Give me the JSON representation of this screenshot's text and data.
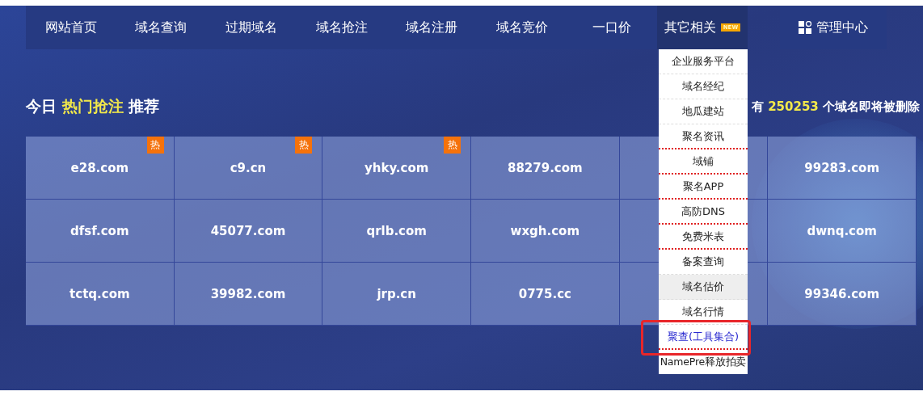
{
  "nav": {
    "items": [
      {
        "label": "网站首页",
        "selected": false
      },
      {
        "label": "域名查询",
        "selected": false
      },
      {
        "label": "过期域名",
        "selected": false
      },
      {
        "label": "域名抢注",
        "selected": false
      },
      {
        "label": "域名注册",
        "selected": false
      },
      {
        "label": "域名竞价",
        "selected": false
      },
      {
        "label": "一口价",
        "selected": false
      },
      {
        "label": "其它相关",
        "selected": true,
        "badge": "NEW"
      }
    ],
    "admin": {
      "label": "管理中心"
    }
  },
  "heading": "今日 **热门抢注** 推荐",
  "notice": {
    "prefix": "有",
    "count": "250253",
    "suffix": "个域名即将被删除"
  },
  "domains": [
    [
      {
        "name": "e28.com",
        "hot": true,
        "badge": "热"
      },
      {
        "name": "c9.cn",
        "hot": true,
        "badge": "热"
      },
      {
        "name": "yhky.com",
        "hot": true,
        "badge": "热"
      },
      {
        "name": "88279.com",
        "hot": false
      },
      {
        "hot": false
      },
      {
        "name": "99283.com",
        "hot": false
      }
    ],
    [
      {
        "name": "dfsf.com",
        "hot": false
      },
      {
        "name": "45077.com",
        "hot": false
      },
      {
        "name": "qrlb.com",
        "hot": false
      },
      {
        "name": "wxgh.com",
        "hot": false
      },
      {
        "hot": false
      },
      {
        "name": "dwnq.com",
        "hot": false
      }
    ],
    [
      {
        "name": "tctq.com",
        "hot": false
      },
      {
        "name": "39982.com",
        "hot": false
      },
      {
        "name": "jrp.cn",
        "hot": false
      },
      {
        "name": "0775.cc",
        "hot": false
      },
      {
        "hot": false
      },
      {
        "name": "99346.com",
        "hot": false
      }
    ]
  ],
  "dropdown": [
    {
      "label": "企业服务平台",
      "selected": false,
      "highlighted": false,
      "kind": "dashed"
    },
    {
      "label": "域名经纪",
      "selected": false,
      "highlighted": false,
      "kind": "dashed"
    },
    {
      "label": "地瓜建站",
      "selected": false,
      "highlighted": false,
      "kind": "dashed"
    },
    {
      "label": "聚名资讯",
      "selected": false,
      "highlighted": false,
      "kind": "dotted"
    },
    {
      "label": "域铺",
      "selected": false,
      "highlighted": false,
      "kind": "dotted"
    },
    {
      "label": "聚名APP",
      "selected": false,
      "highlighted": false,
      "kind": "dotted"
    },
    {
      "label": "高防DNS",
      "selected": false,
      "highlighted": false,
      "kind": "dotted"
    },
    {
      "label": "免费米表",
      "selected": false,
      "highlighted": false,
      "kind": "dotted"
    },
    {
      "label": "备案查询",
      "selected": false,
      "highlighted": false,
      "kind": "dashed"
    },
    {
      "label": "域名估价",
      "selected": true,
      "highlighted": false,
      "kind": "dashed"
    },
    {
      "label": "域名行情",
      "selected": false,
      "highlighted": false,
      "kind": "dashed"
    },
    {
      "label": "聚查(工具集合)",
      "selected": false,
      "highlighted": true,
      "kind": "dotted"
    },
    {
      "label": "NamePre释放拍卖",
      "selected": false,
      "highlighted": false,
      "kind": "none"
    }
  ]
}
